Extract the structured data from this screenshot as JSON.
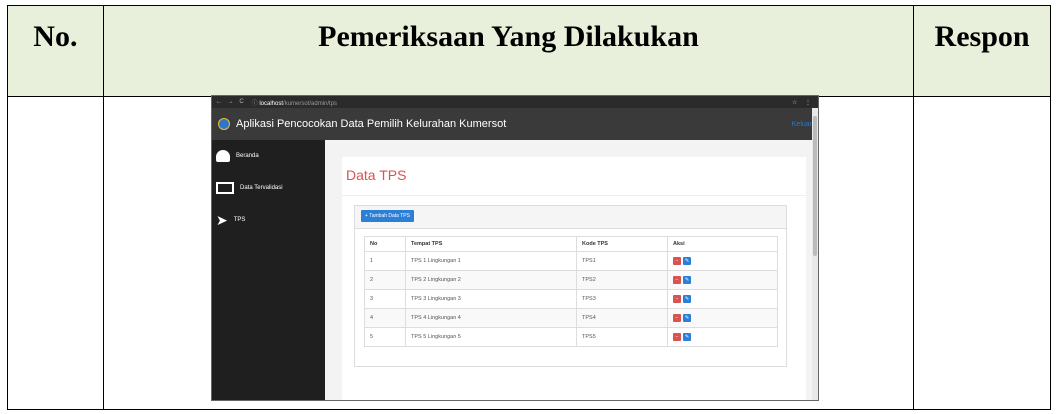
{
  "doc_table": {
    "headers": [
      "No.",
      "Pemeriksaan Yang Dilakukan",
      "Respon"
    ]
  },
  "browser": {
    "url_host": "localhost",
    "url_path": "/kumersot/admin/tps"
  },
  "app": {
    "title": "Aplikasi Pencocokan Data Pemilih Kelurahan Kumersot",
    "logout_label": "Keluar"
  },
  "sidebar": {
    "items": [
      {
        "label": "Beranda",
        "icon": "dashboard-icon"
      },
      {
        "label": "Data Tervalidasi",
        "icon": "monitor-icon"
      },
      {
        "label": "TPS",
        "icon": "location-arrow-icon"
      }
    ]
  },
  "page": {
    "title": "Data TPS",
    "add_button_label": "+ Tambah Data TPS"
  },
  "table": {
    "columns": [
      "No",
      "Tempat TPS",
      "Kode TPS",
      "Aksi"
    ],
    "rows": [
      {
        "no": "1",
        "tempat": "TPS 1 Lingkungan 1",
        "kode": "TPS1"
      },
      {
        "no": "2",
        "tempat": "TPS 2 Lingkungan 2",
        "kode": "TPS2"
      },
      {
        "no": "3",
        "tempat": "TPS 3 Lingkungan 3",
        "kode": "TPS3"
      },
      {
        "no": "4",
        "tempat": "TPS 4 Lingkungan 4",
        "kode": "TPS4"
      },
      {
        "no": "5",
        "tempat": "TPS 5 Lingkungan 5",
        "kode": "TPS5"
      }
    ]
  },
  "colors": {
    "header_bg": "#e8f0dc",
    "accent_red": "#d9534f",
    "accent_blue": "#2c7fd6",
    "sidebar_bg": "#1f1f1f"
  }
}
